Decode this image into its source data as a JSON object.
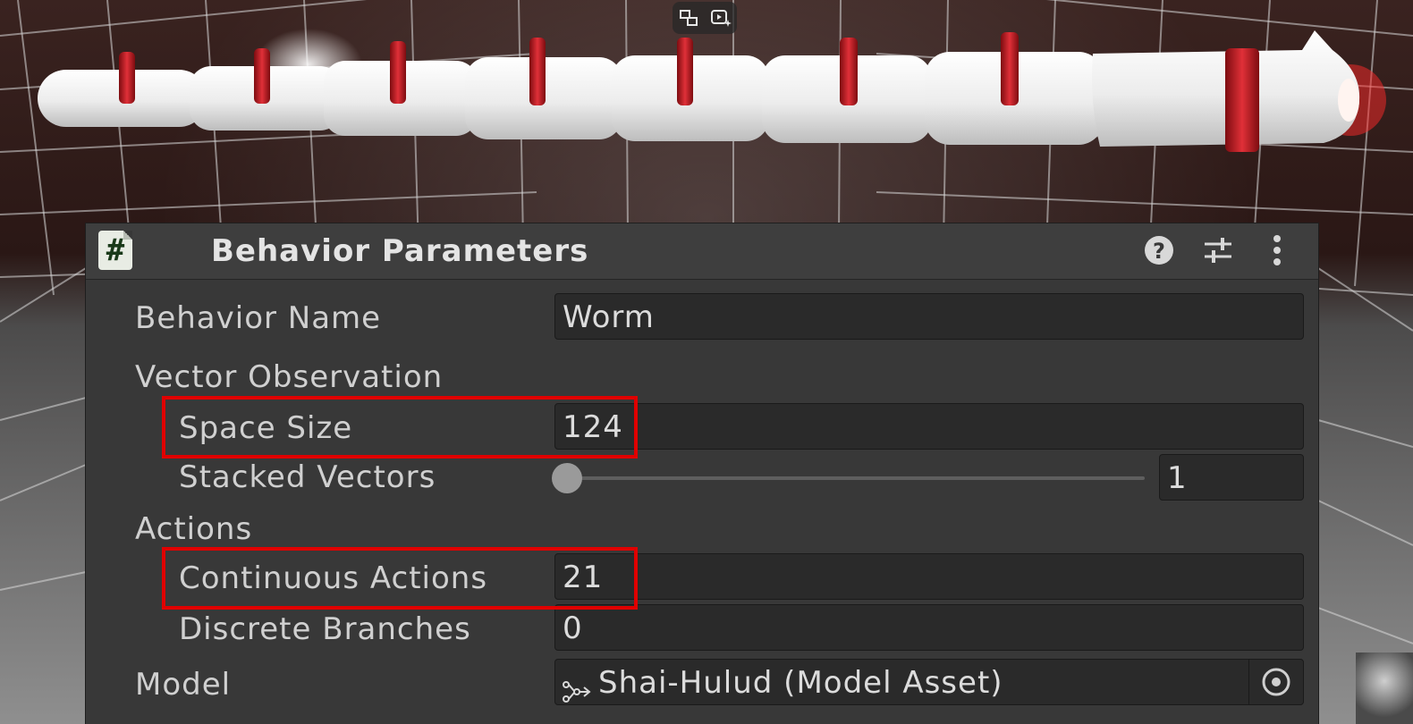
{
  "panel": {
    "title": "Behavior Parameters",
    "script_icon_glyph": "#"
  },
  "fields": {
    "behavior_name": {
      "label": "Behavior Name",
      "value": "Worm"
    },
    "vector_observation": {
      "label": "Vector Observation"
    },
    "space_size": {
      "label": "Space Size",
      "value": "124"
    },
    "stacked_vectors": {
      "label": "Stacked Vectors",
      "value": "1",
      "slider_fraction": 0.0
    },
    "actions": {
      "label": "Actions"
    },
    "continuous_actions": {
      "label": "Continuous Actions",
      "value": "21"
    },
    "discrete_branches": {
      "label": "Discrete Branches",
      "value": "0"
    },
    "model": {
      "label": "Model",
      "value": "Shai-Hulud (Model Asset)"
    }
  },
  "icons": {
    "help": "help-icon",
    "presets": "presets-icon",
    "more": "more-vertical-icon",
    "model_asset": "model-asset-icon",
    "object_picker": "object-picker-icon",
    "player_toggle_1": "swap-view-icon",
    "player_toggle_2": "play-sparkle-icon"
  },
  "colors": {
    "panel_bg": "#383838",
    "field_bg": "#2a2a2a",
    "highlight": "#e00000",
    "band_red": "#c0141b",
    "worm_body": "#f1f1f1"
  }
}
